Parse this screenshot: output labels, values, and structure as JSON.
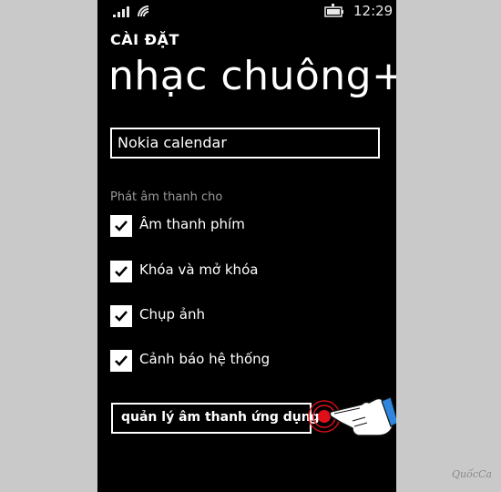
{
  "status_bar": {
    "time": "12:29",
    "icons": [
      "signal-icon",
      "wifi-icon",
      "battery-icon"
    ]
  },
  "header": {
    "settings_label": "CÀI ĐẶT",
    "title": "nhạc chuông+â"
  },
  "ringtone_field": {
    "value": "Nokia calendar"
  },
  "sound_section": {
    "label": "Phát âm thanh cho",
    "items": [
      {
        "label": "Âm thanh phím",
        "checked": true
      },
      {
        "label": "Khóa và mở khóa",
        "checked": true
      },
      {
        "label": "Chụp ảnh",
        "checked": true
      },
      {
        "label": "Cảnh báo hệ thống",
        "checked": true
      }
    ]
  },
  "app_sound_button": {
    "label": "quản lý âm thanh ứng dụng"
  },
  "watermark": "QuốcCa",
  "colors": {
    "background": "#000000",
    "foreground": "#ffffff",
    "muted": "#9a9a9a",
    "frame": "#c9c9c9",
    "tap_highlight": "#e0101a",
    "hand_accent": "#2e86de"
  }
}
